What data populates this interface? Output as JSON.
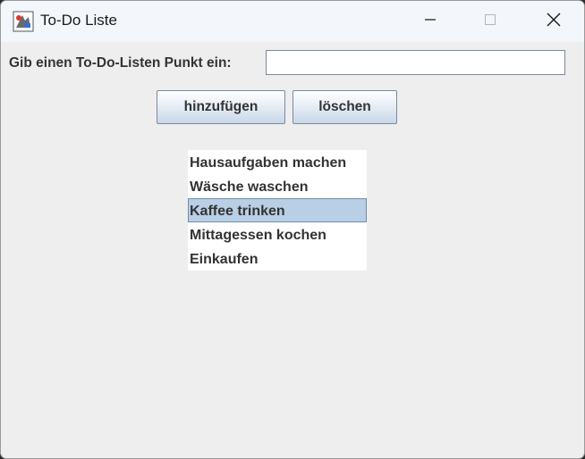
{
  "window": {
    "title": "To-Do Liste",
    "icon": "java-app-icon",
    "controls": [
      "minimize-icon",
      "maximize-icon",
      "close-icon"
    ]
  },
  "form": {
    "prompt_label": "Gib einen To-Do-Listen Punkt ein:",
    "input_value": "",
    "input_placeholder": ""
  },
  "buttons": {
    "add_label": "hinzufügen",
    "delete_label": "löschen"
  },
  "list": {
    "items": [
      "Hausaufgaben machen",
      "Wäsche waschen",
      "Kaffee trinken",
      "Mittagessen kochen",
      "Einkaufen"
    ],
    "selected_index": 2
  },
  "colors": {
    "window_bg": "#eeeeee",
    "titlebar_bg": "#f3f6fb",
    "selection_bg": "#b8cfe5",
    "selection_border": "#6f8dae",
    "text": "#333333"
  }
}
